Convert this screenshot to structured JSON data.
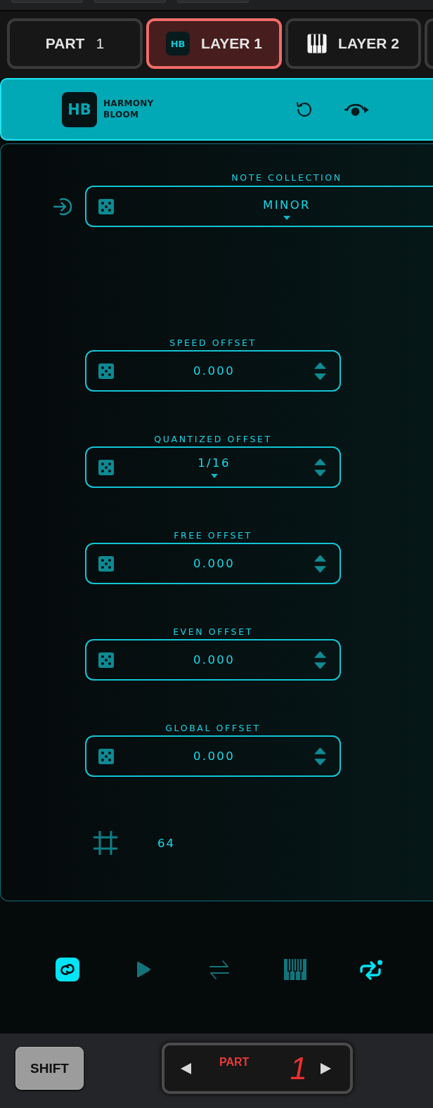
{
  "top_buttons": [
    {
      "kind": "cut-off"
    },
    {
      "kind": "cut-off"
    },
    {
      "kind": "cut-off"
    }
  ],
  "tabs": [
    {
      "kind": "part",
      "label": "PART",
      "number": "1",
      "selected": false
    },
    {
      "kind": "badge",
      "badge": "HB",
      "label": "LAYER 1",
      "selected": true
    },
    {
      "kind": "piano",
      "label": "LAYER 2",
      "selected": false
    },
    {
      "kind": "cut-off",
      "selected": false
    }
  ],
  "header": {
    "badge": "HB",
    "title": "HARMONY BLOOM"
  },
  "note_collection": {
    "label": "NOTE COLLECTION",
    "value": "MINOR"
  },
  "offsets": [
    {
      "kind": "number",
      "label": "SPEED OFFSET",
      "value": "0.000"
    },
    {
      "kind": "choice",
      "label": "QUANTIZED OFFSET",
      "value": "1/16"
    },
    {
      "kind": "number",
      "label": "FREE OFFSET",
      "value": "0.000"
    },
    {
      "kind": "number",
      "label": "EVEN OFFSET",
      "value": "0.000"
    },
    {
      "kind": "number",
      "label": "GLOBAL OFFSET",
      "value": "0.000"
    }
  ],
  "steps": {
    "value": "64"
  },
  "toolbar": [
    {
      "kind": "link",
      "on": true
    },
    {
      "kind": "play",
      "on": false
    },
    {
      "kind": "swap",
      "on": false
    },
    {
      "kind": "piano",
      "on": false
    },
    {
      "kind": "repeat",
      "on": true
    }
  ],
  "shift_button": {
    "label": "SHIFT"
  },
  "part_selector": {
    "label": "PART",
    "value": "1"
  }
}
